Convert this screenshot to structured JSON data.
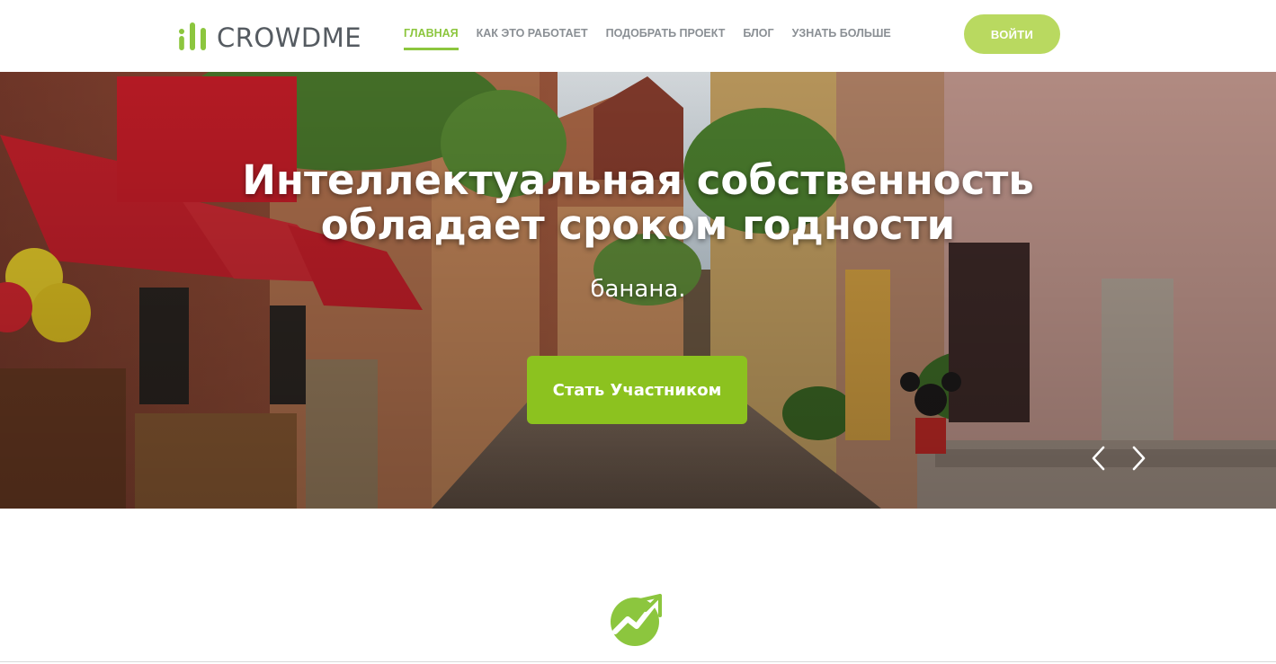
{
  "header": {
    "logo_text": "CROWDME",
    "logo_icon": "bars-logo-icon",
    "nav": [
      {
        "label": "ГЛАВНАЯ",
        "active": true
      },
      {
        "label": "КАК ЭТО РАБОТАЕТ",
        "active": false
      },
      {
        "label": "ПОДОБРАТЬ ПРОЕКТ",
        "active": false
      },
      {
        "label": "БЛОГ",
        "active": false
      },
      {
        "label": "УЗНАТЬ БОЛЬШЕ",
        "active": false
      }
    ],
    "login_label": "ВОЙТИ"
  },
  "hero": {
    "title_line1": "Интеллектуальная собственность",
    "title_line2": "обладает сроком годности",
    "subtitle": "банана.",
    "cta_label": "Стать Участником",
    "prev_icon": "chevron-left-icon",
    "next_icon": "chevron-right-icon"
  },
  "feature": {
    "icon": "growth-chart-icon"
  },
  "colors": {
    "accent": "#8cc63e",
    "cta": "#8cc21f",
    "login": "#b9d960",
    "nav_text": "#8a8f94",
    "logo_text": "#555b61"
  }
}
